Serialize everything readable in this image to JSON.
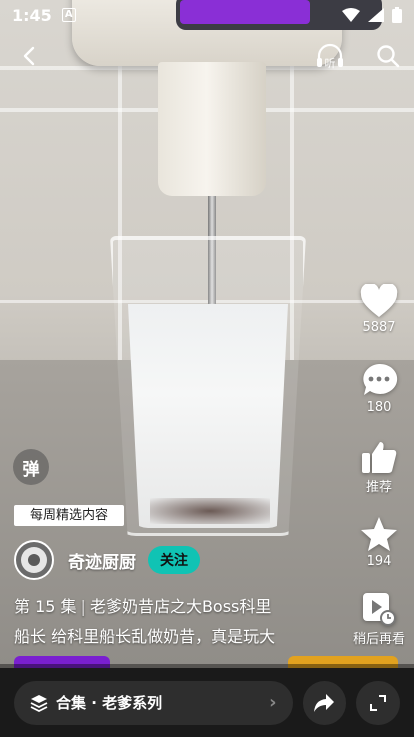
{
  "status_bar": {
    "time": "1:45",
    "notification_badge": "A"
  },
  "top_nav": {
    "back_icon": "back-arrow-icon",
    "listen_label": "听",
    "search_icon": "search-icon"
  },
  "actions": {
    "like_count": "5887",
    "comment_count": "180",
    "recommend_label": "推荐",
    "favorite_count": "194",
    "watch_later_label": "稍后再看"
  },
  "danmaku": {
    "label": "弹"
  },
  "video_info": {
    "weekly_tag": "每周精选内容",
    "author": "奇迹厨厨",
    "follow_label": "关注",
    "episode": "第 15 集",
    "series_title": "老爹奶昔店之大Boss科里",
    "description": "船长 给科里船长乱做奶昔，真是玩大"
  },
  "bottom_bar": {
    "collection_label": "合集 · 老爹系列"
  },
  "colors": {
    "follow": "#10c3b4",
    "progress_left": "#7a1fd0",
    "progress_right": "#e2a21f"
  }
}
